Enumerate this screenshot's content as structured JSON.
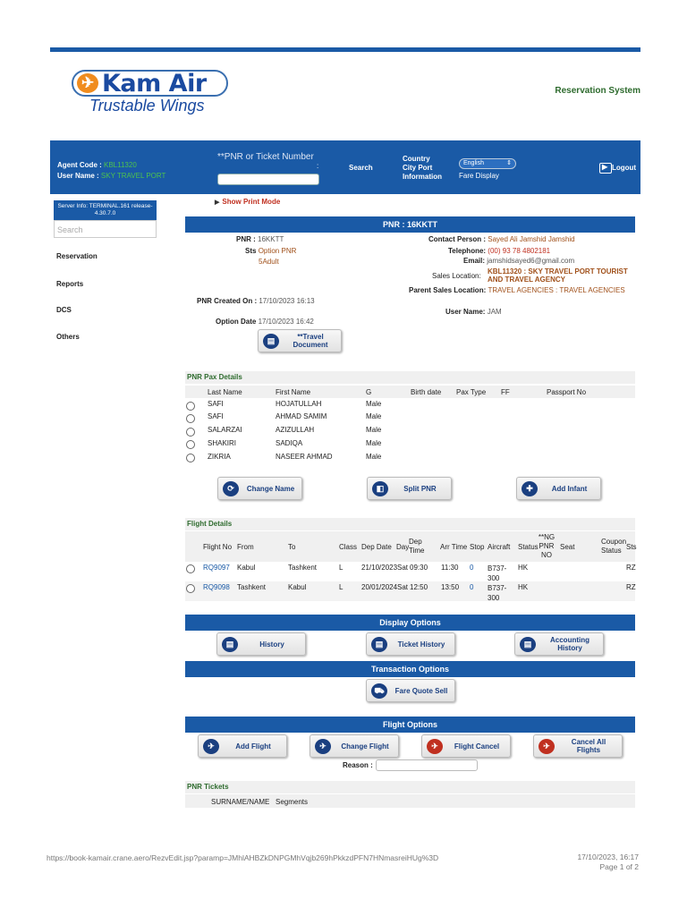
{
  "brand": {
    "name": "Kam Air",
    "tagline": "Trustable Wings",
    "system": "Reservation System"
  },
  "header": {
    "agent_code_label": "Agent Code : ",
    "agent_code": "KBL11320",
    "user_name_label": "User Name : ",
    "user_name": "SKY TRAVEL PORT",
    "pnr_label": "**PNR or Ticket Number",
    "pnr_colon": ":",
    "search": "Search",
    "country": "Country",
    "city_port": "City Port",
    "information": "Information",
    "language": "English",
    "fare_display": "Fare Display",
    "logout": "Logout"
  },
  "sidebar": {
    "server_info": "Server Info: TERMINAL.161 release-4.30.7.0",
    "search_placeholder": "Search",
    "items": [
      "Reservation",
      "Reports",
      "DCS",
      "Others"
    ]
  },
  "print_mode": "Show Print Mode",
  "pnr_title": "PNR : 16KKTT",
  "pnr": {
    "pnr_label": "PNR : ",
    "pnr_value": "16KKTT",
    "sts_label": "Sts",
    "sts_value": "Option PNR",
    "adult": "5Adult",
    "created_label": "PNR Created On : ",
    "created_value": "17/10/2023 16:13",
    "option_label": "Option Date ",
    "option_value": "17/10/2023 16:42",
    "contact_label": "Contact Person : ",
    "contact_value": "Sayed Ali Jamshid Jamshid",
    "tel_label": "Telephone: ",
    "tel_value": "(00) 93 78 4802181",
    "email_label": "Email: ",
    "email_value": "jamshidsayed6@gmail.com",
    "sales_label": "Sales Location: ",
    "sales_value": "KBL11320 : SKY TRAVEL PORT TOURIST AND TRAVEL AGENCY",
    "parent_label": "Parent Sales Location: ",
    "parent_value": "TRAVEL AGENCIES : TRAVEL AGENCIES",
    "username_label": "User Name: ",
    "username_value": "JAM",
    "travel_doc": "**Travel Document"
  },
  "pax": {
    "title": "PNR Pax Details",
    "headers": [
      "Last Name",
      "First Name",
      "G",
      "Birth date",
      "Pax Type",
      "FF",
      "Passport No"
    ],
    "rows": [
      [
        "SAFI",
        "HOJATULLAH",
        "Male"
      ],
      [
        "SAFI",
        "AHMAD SAMIM",
        "Male"
      ],
      [
        "SALARZAI",
        "AZIZULLAH",
        "Male"
      ],
      [
        "SHAKIRI",
        "SADIQA",
        "Male"
      ],
      [
        "ZIKRIA",
        "NASEER AHMAD",
        "Male"
      ]
    ],
    "buttons": [
      "Change Name",
      "Split PNR",
      "Add Infant"
    ]
  },
  "flights": {
    "title": "Flight Details",
    "headers": [
      "Flight No",
      "From",
      "To",
      "Class",
      "Dep Date",
      "Day",
      "Dep Time",
      "Arr Time",
      "Stop",
      "Aircraft",
      "Status",
      "**NG PNR NO",
      "Seat",
      "Coupon Status",
      "Sts"
    ],
    "rows": [
      [
        "RQ9097",
        "Kabul",
        "Tashkent",
        "L",
        "21/10/2023",
        "Sat",
        "09:30",
        "11:30",
        "0",
        "B737-300",
        "HK",
        "",
        "",
        "",
        "RZ"
      ],
      [
        "RQ9098",
        "Tashkent",
        "Kabul",
        "L",
        "20/01/2024",
        "Sat",
        "12:50",
        "13:50",
        "0",
        "B737-300",
        "HK",
        "",
        "",
        "",
        "RZ"
      ]
    ]
  },
  "display_options": {
    "title": "Display Options",
    "buttons": [
      "History",
      "Ticket History",
      "Accounting History"
    ]
  },
  "transaction_options": {
    "title": "Transaction Options",
    "buttons": [
      "Fare Quote Sell"
    ]
  },
  "flight_options": {
    "title": "Flight Options",
    "buttons": [
      "Add Flight",
      "Change Flight",
      "Flight Cancel",
      "Cancel All Flights"
    ],
    "reason_label": "Reason :"
  },
  "tickets": {
    "title": "PNR Tickets",
    "headers": [
      "SURNAME/NAME",
      "Segments"
    ]
  },
  "footer": {
    "url": "https://book-kamair.crane.aero/RezvEdit.jsp?paramp=JMhlAHBZkDNPGMhVqjb269hPkkzdPFN7HNmasreiHUg%3D",
    "datetime": "17/10/2023, 16:17",
    "page": "Page 1 of 2"
  }
}
